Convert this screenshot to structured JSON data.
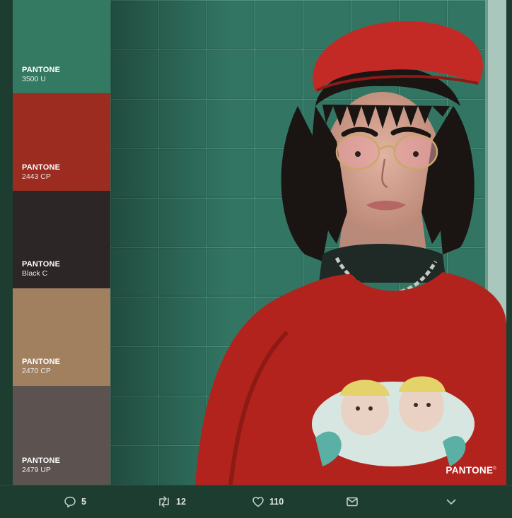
{
  "palette": [
    {
      "brand": "PANTONE",
      "code": "3500 U",
      "color": "#347a62"
    },
    {
      "brand": "PANTONE",
      "code": "2443 CP",
      "color": "#9c2b20"
    },
    {
      "brand": "PANTONE",
      "code": "Black C",
      "color": "#2c2626"
    },
    {
      "brand": "PANTONE",
      "code": "2470 CP",
      "color": "#a0805f"
    },
    {
      "brand": "PANTONE",
      "code": "2479 UP",
      "color": "#5c5250"
    }
  ],
  "watermark": {
    "text": "PANTONE",
    "mark": "®"
  },
  "actions": {
    "reply": {
      "icon": "reply-icon",
      "count": "5"
    },
    "retweet": {
      "icon": "retweet-icon",
      "count": "12"
    },
    "like": {
      "icon": "heart-icon",
      "count": "110"
    },
    "dm": {
      "icon": "envelope-icon"
    },
    "more": {
      "icon": "chevron-down-icon"
    }
  },
  "colors": {
    "background": "#1d3d31",
    "tile_wall": "#2f6e5c",
    "sweater": "#b3231d",
    "beret": "#c42a25"
  }
}
